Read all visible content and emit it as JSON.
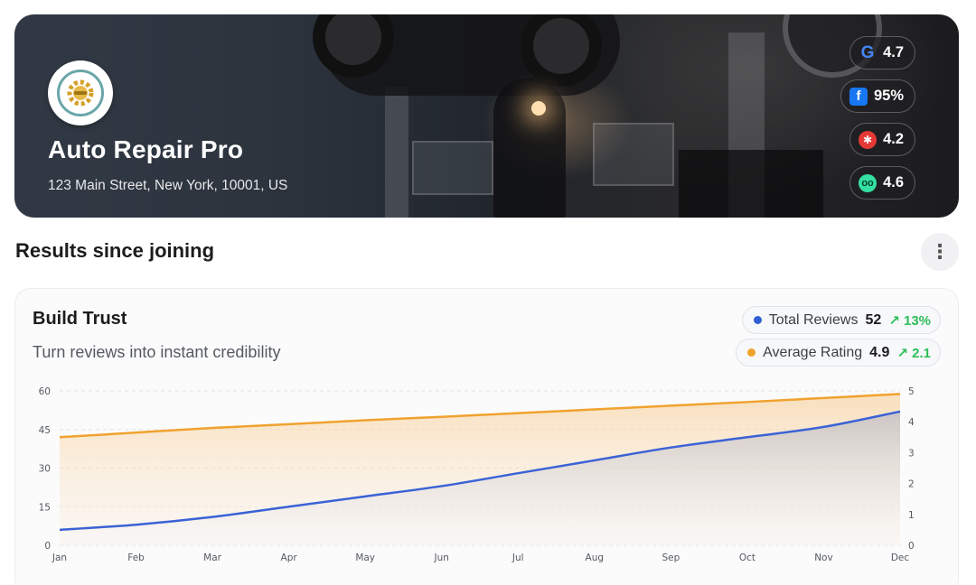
{
  "business": {
    "name": "Auto Repair Pro",
    "address": "123 Main Street, New York, 10001, US",
    "logo_icon": "gear-wrench-logo"
  },
  "ratings": [
    {
      "source": "google",
      "icon": "google-icon",
      "glyph": "G",
      "value": "4.7"
    },
    {
      "source": "facebook",
      "icon": "facebook-icon",
      "glyph": "f",
      "value": "95%"
    },
    {
      "source": "yelp",
      "icon": "yelp-icon",
      "glyph": "✱",
      "value": "4.2"
    },
    {
      "source": "tripadvisor",
      "icon": "tripadvisor-icon",
      "glyph": "oo",
      "value": "4.6"
    }
  ],
  "section": {
    "title": "Results since joining",
    "more_glyph": "⋮"
  },
  "card": {
    "title": "Build Trust",
    "subtitle": "Turn reviews into instant credibility"
  },
  "metrics": [
    {
      "label": "Total Reviews",
      "value": "52",
      "delta": "↗ 13%",
      "color": "#2f5fd0"
    },
    {
      "label": "Average Rating",
      "value": "4.9",
      "delta": "↗ 2.1",
      "color": "#f0a22e"
    }
  ],
  "chart_data": {
    "type": "area",
    "categories": [
      "Jan",
      "Feb",
      "Mar",
      "Apr",
      "May",
      "Jun",
      "Jul",
      "Aug",
      "Sep",
      "Oct",
      "Nov",
      "Dec"
    ],
    "left_axis": {
      "ticks": [
        0,
        15,
        30,
        45,
        60
      ],
      "ylim": [
        0,
        60
      ]
    },
    "right_axis": {
      "ticks": [
        0,
        1,
        2,
        3,
        4,
        5
      ],
      "ylim": [
        0,
        5
      ]
    },
    "series": [
      {
        "name": "Total Reviews",
        "axis": "left",
        "color": "#3b62d6",
        "values": [
          6,
          8,
          11,
          15,
          19,
          23,
          28,
          33,
          38,
          42,
          46,
          52
        ]
      },
      {
        "name": "Average Rating",
        "axis": "right",
        "color": "#f0a22e",
        "values": [
          3.5,
          3.65,
          3.8,
          3.92,
          4.05,
          4.16,
          4.28,
          4.4,
          4.52,
          4.64,
          4.77,
          4.9
        ]
      }
    ],
    "grid": true,
    "legend": "top-right"
  },
  "colors": {
    "accent_blue": "#3b62d6",
    "accent_orange": "#f0a22e",
    "positive": "#2ebd59"
  }
}
